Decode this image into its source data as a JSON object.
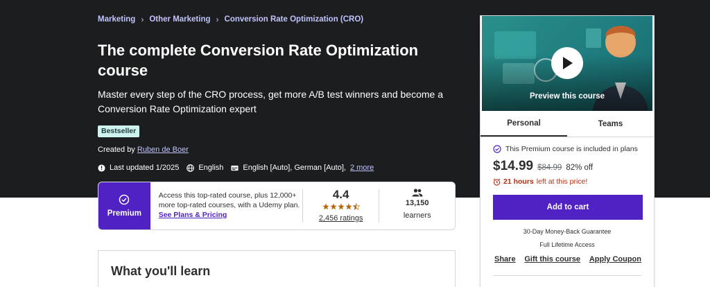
{
  "breadcrumb": [
    "Marketing",
    "Other Marketing",
    "Conversion Rate Optimization (CRO)"
  ],
  "title": "The complete Conversion Rate Optimization course",
  "subtitle": "Master every step of the CRO process, get more A/B test winners and become a Conversion Rate Optimization expert",
  "badge": "Bestseller",
  "created": {
    "prefix": "Created by",
    "author": "Ruben de Boer"
  },
  "meta": {
    "updated": "Last updated 1/2025",
    "language": "English",
    "captions": "English [Auto], German [Auto],",
    "more": "2 more"
  },
  "premium_card": {
    "label": "Premium",
    "text": "Access this top-rated course, plus 12,000+ more top-rated courses, with a Udemy plan.",
    "link": "See Plans & Pricing",
    "rating": "4.4",
    "stars": 4.4,
    "ratings_count": "2,456 ratings",
    "learners": "13,150",
    "learners_label": "learners"
  },
  "learn": {
    "heading": "What you'll learn"
  },
  "sidebar": {
    "preview_label": "Preview this course",
    "tabs": [
      "Personal",
      "Teams"
    ],
    "plans_text": "This Premium course is included in plans",
    "price": "$14.99",
    "original_price": "$84.99",
    "discount": "82% off",
    "timer_bold": "21 hours",
    "timer_rest": "left at this price!",
    "add_to_cart": "Add to cart",
    "guarantee": "30-Day Money-Back Guarantee",
    "access": "Full Lifetime Access",
    "share": "Share",
    "gift": "Gift this course",
    "coupon": "Apply Coupon"
  },
  "colors": {
    "hero_bg": "#1c1d1f",
    "accent": "#5022c3",
    "link": "#c0c4fc",
    "badge_bg": "#cef3ee",
    "star": "#b4690e",
    "timer": "#b32d0f"
  },
  "icons": [
    "chevron-right-icon",
    "alert-icon",
    "globe-icon",
    "captions-icon",
    "premium-icon",
    "star-icon",
    "users-icon",
    "play-icon",
    "check-circle-icon",
    "alarm-icon"
  ]
}
